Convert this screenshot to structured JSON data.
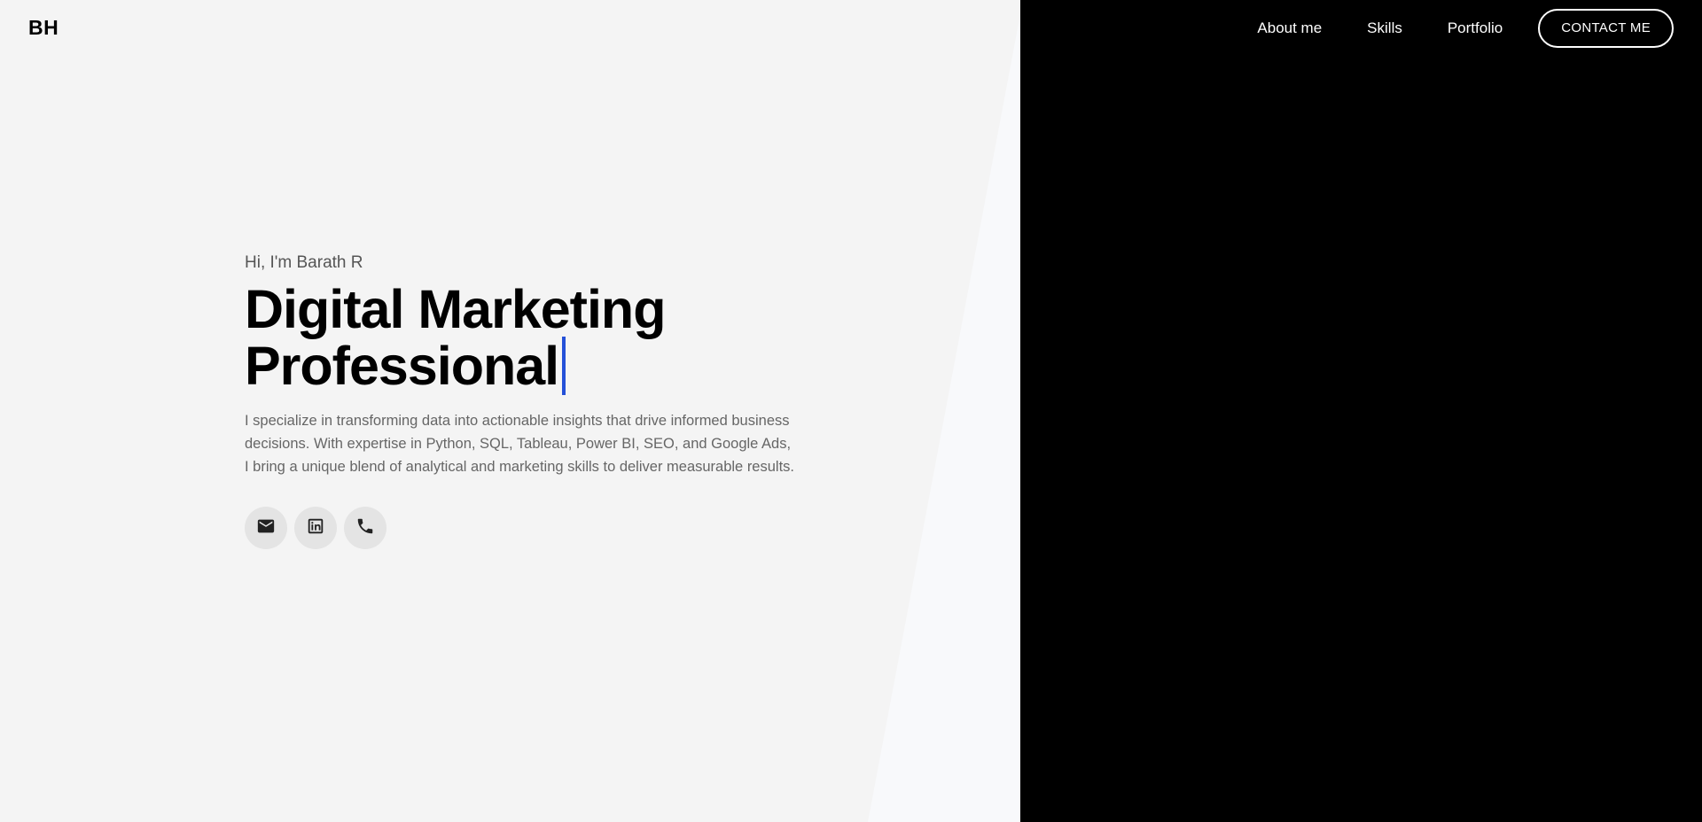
{
  "logo": "BH",
  "nav": {
    "items": [
      {
        "label": "About me"
      },
      {
        "label": "Skills"
      },
      {
        "label": "Portfolio"
      }
    ],
    "contact_label": "CONTACT ME"
  },
  "hero": {
    "greeting": "Hi, I'm Barath R",
    "headline_line1": "Digital Marketing",
    "headline_line2": "Professional",
    "description": "I specialize in transforming data into actionable insights that drive informed business decisions. With expertise in Python, SQL, Tableau, Power BI, SEO, and Google Ads, I bring a unique blend of analytical and marketing skills to deliver measurable results."
  },
  "socials": [
    {
      "icon": "email-icon"
    },
    {
      "icon": "linkedin-icon"
    },
    {
      "icon": "phone-icon"
    }
  ],
  "colors": {
    "accent_cursor": "#2450d8",
    "dark_panel": "#000000",
    "light_bg": "#f4f4f4"
  }
}
